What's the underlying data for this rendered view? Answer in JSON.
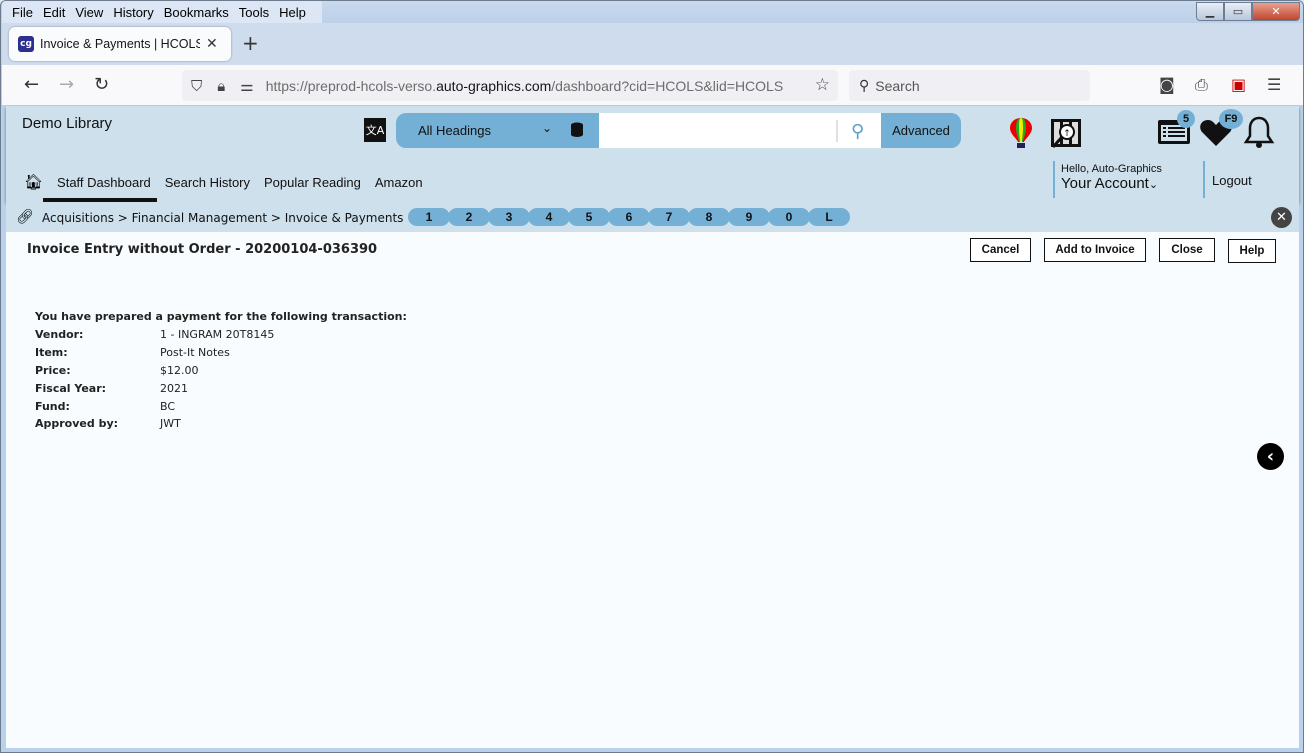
{
  "browser": {
    "menu": [
      "File",
      "Edit",
      "View",
      "History",
      "Bookmarks",
      "Tools",
      "Help"
    ],
    "tab": {
      "title": "Invoice & Payments | HCOLS | h",
      "favicon": "cg"
    },
    "url": {
      "prefix": "https://preprod-hcols-verso.",
      "domain": "auto-graphics.com",
      "suffix": "/dashboard?cid=HCOLS&lid=HCOLS"
    },
    "search_placeholder": "Search"
  },
  "header": {
    "library_name": "Demo Library",
    "search": {
      "scope": "All Headings",
      "advanced_label": "Advanced",
      "query": ""
    },
    "badges": {
      "list": "5",
      "favorites": "F9"
    },
    "nav": [
      "Staff Dashboard",
      "Search History",
      "Popular Reading",
      "Amazon"
    ],
    "account": {
      "greeting": "Hello, Auto-Graphics",
      "label": "Your Account",
      "logout": "Logout"
    }
  },
  "breadcrumb": {
    "path": "Acquisitions > Financial Management > Invoice & Payments",
    "quick_keys": [
      "1",
      "2",
      "3",
      "4",
      "5",
      "6",
      "7",
      "8",
      "9",
      "0",
      "L"
    ]
  },
  "page": {
    "title": "Invoice Entry without Order - 20200104-036390",
    "buttons": {
      "cancel": "Cancel",
      "add": "Add to Invoice",
      "close": "Close",
      "help": "Help"
    },
    "intro": "You have prepared a payment for the following transaction:",
    "fields": [
      {
        "label": "Vendor:",
        "value": "1 - INGRAM 20T8145"
      },
      {
        "label": "Item:",
        "value": "Post-It Notes"
      },
      {
        "label": "Price:",
        "value": "$12.00"
      },
      {
        "label": "Fiscal Year:",
        "value": "2021"
      },
      {
        "label": "Fund:",
        "value": "BC"
      },
      {
        "label": "Approved by:",
        "value": "JWT"
      }
    ]
  }
}
